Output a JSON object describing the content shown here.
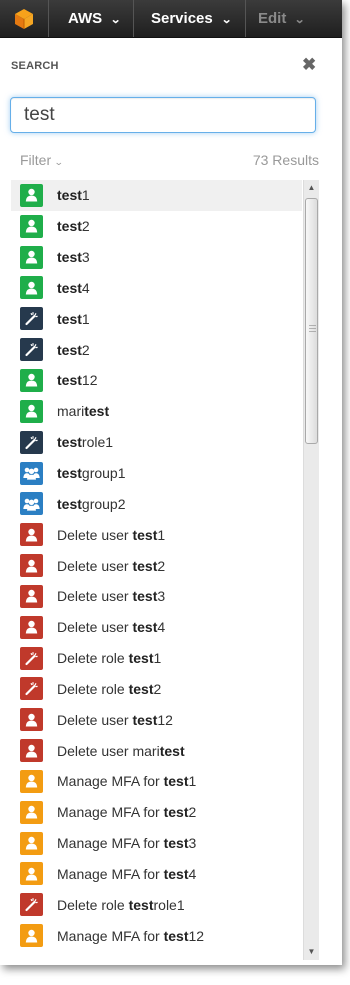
{
  "nav": {
    "logo_icon": "aws-cube-icon",
    "items": [
      {
        "label": "AWS"
      },
      {
        "label": "Services"
      },
      {
        "label": "Edit"
      }
    ]
  },
  "search": {
    "title": "SEARCH",
    "close_icon": "close-icon",
    "query": "test",
    "filter_label": "Filter",
    "results_count": "73 Results"
  },
  "colors": {
    "user": "#1fae4a",
    "role": "#26394d",
    "group": "#2b7fc3",
    "delete": "#c0392b",
    "mfa": "#f39c12",
    "focus": "#66afe9"
  },
  "results": [
    {
      "type": "user",
      "parts": [
        [
          "b",
          "test"
        ],
        [
          "n",
          "1"
        ]
      ]
    },
    {
      "type": "user",
      "parts": [
        [
          "b",
          "test"
        ],
        [
          "n",
          "2"
        ]
      ]
    },
    {
      "type": "user",
      "parts": [
        [
          "b",
          "test"
        ],
        [
          "n",
          "3"
        ]
      ]
    },
    {
      "type": "user",
      "parts": [
        [
          "b",
          "test"
        ],
        [
          "n",
          "4"
        ]
      ]
    },
    {
      "type": "role",
      "parts": [
        [
          "b",
          "test"
        ],
        [
          "n",
          "1"
        ]
      ]
    },
    {
      "type": "role",
      "parts": [
        [
          "b",
          "test"
        ],
        [
          "n",
          "2"
        ]
      ]
    },
    {
      "type": "user",
      "parts": [
        [
          "b",
          "test"
        ],
        [
          "n",
          "12"
        ]
      ]
    },
    {
      "type": "user",
      "parts": [
        [
          "n",
          "mari"
        ],
        [
          "b",
          "test"
        ]
      ]
    },
    {
      "type": "role",
      "parts": [
        [
          "b",
          "test"
        ],
        [
          "n",
          "role1"
        ]
      ]
    },
    {
      "type": "group",
      "parts": [
        [
          "b",
          "test"
        ],
        [
          "n",
          "group1"
        ]
      ]
    },
    {
      "type": "group",
      "parts": [
        [
          "b",
          "test"
        ],
        [
          "n",
          "group2"
        ]
      ]
    },
    {
      "type": "delete-user",
      "parts": [
        [
          "n",
          "Delete user "
        ],
        [
          "b",
          "test"
        ],
        [
          "n",
          "1"
        ]
      ]
    },
    {
      "type": "delete-user",
      "parts": [
        [
          "n",
          "Delete user "
        ],
        [
          "b",
          "test"
        ],
        [
          "n",
          "2"
        ]
      ]
    },
    {
      "type": "delete-user",
      "parts": [
        [
          "n",
          "Delete user "
        ],
        [
          "b",
          "test"
        ],
        [
          "n",
          "3"
        ]
      ]
    },
    {
      "type": "delete-user",
      "parts": [
        [
          "n",
          "Delete user "
        ],
        [
          "b",
          "test"
        ],
        [
          "n",
          "4"
        ]
      ]
    },
    {
      "type": "delete-role",
      "parts": [
        [
          "n",
          "Delete role "
        ],
        [
          "b",
          "test"
        ],
        [
          "n",
          "1"
        ]
      ]
    },
    {
      "type": "delete-role",
      "parts": [
        [
          "n",
          "Delete role "
        ],
        [
          "b",
          "test"
        ],
        [
          "n",
          "2"
        ]
      ]
    },
    {
      "type": "delete-user",
      "parts": [
        [
          "n",
          "Delete user "
        ],
        [
          "b",
          "test"
        ],
        [
          "n",
          "12"
        ]
      ]
    },
    {
      "type": "delete-user",
      "parts": [
        [
          "n",
          "Delete user mari"
        ],
        [
          "b",
          "test"
        ]
      ]
    },
    {
      "type": "mfa",
      "parts": [
        [
          "n",
          "Manage MFA for "
        ],
        [
          "b",
          "test"
        ],
        [
          "n",
          "1"
        ]
      ]
    },
    {
      "type": "mfa",
      "parts": [
        [
          "n",
          "Manage MFA for "
        ],
        [
          "b",
          "test"
        ],
        [
          "n",
          "2"
        ]
      ]
    },
    {
      "type": "mfa",
      "parts": [
        [
          "n",
          "Manage MFA for "
        ],
        [
          "b",
          "test"
        ],
        [
          "n",
          "3"
        ]
      ]
    },
    {
      "type": "mfa",
      "parts": [
        [
          "n",
          "Manage MFA for "
        ],
        [
          "b",
          "test"
        ],
        [
          "n",
          "4"
        ]
      ]
    },
    {
      "type": "delete-role",
      "parts": [
        [
          "n",
          "Delete role "
        ],
        [
          "b",
          "test"
        ],
        [
          "n",
          "role1"
        ]
      ]
    },
    {
      "type": "mfa",
      "parts": [
        [
          "n",
          "Manage MFA for "
        ],
        [
          "b",
          "test"
        ],
        [
          "n",
          "12"
        ]
      ]
    }
  ],
  "highlighted_index": 0
}
